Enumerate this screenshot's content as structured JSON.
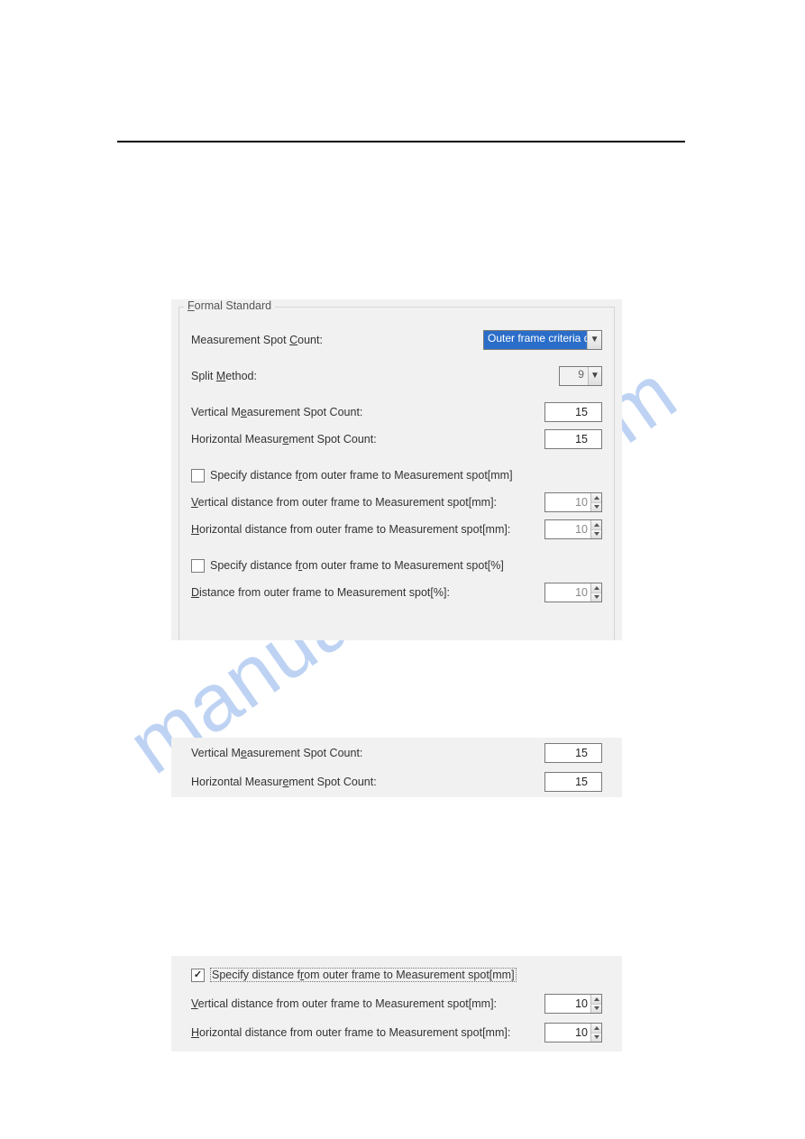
{
  "panel1": {
    "legend": "Formal Standard",
    "measurement_spot_count_label": "Measurement Spot Count:",
    "measurement_spot_count_value": "Outer frame criteria d",
    "split_method_label": "Split Method:",
    "split_method_value": "9",
    "vertical_count_label": "Vertical Measurement Spot Count:",
    "vertical_count_value": "15",
    "horizontal_count_label": "Horizontal Measurement Spot Count:",
    "horizontal_count_value": "15",
    "chk_mm_label": "Specify distance from outer frame to Measurement spot[mm]",
    "chk_mm_checked": false,
    "vdist_mm_label": "Vertical distance from outer frame to Measurement spot[mm]:",
    "vdist_mm_value": "10",
    "hdist_mm_label": "Horizontal distance from outer frame to Measurement spot[mm]:",
    "hdist_mm_value": "10",
    "chk_pct_label": "Specify distance from outer frame to Measurement spot[%]",
    "chk_pct_checked": false,
    "dist_pct_label": "Distance from outer frame to Measurement spot[%]:",
    "dist_pct_value": "10"
  },
  "panel2": {
    "vertical_count_label": "Vertical Measurement Spot Count:",
    "vertical_count_value": "15",
    "horizontal_count_label": "Horizontal Measurement Spot Count:",
    "horizontal_count_value": "15"
  },
  "panel3": {
    "chk_mm_label": "Specify distance from outer frame to Measurement spot[mm]",
    "chk_mm_checked": true,
    "vdist_mm_label": "Vertical distance from outer frame to Measurement spot[mm]:",
    "vdist_mm_value": "10",
    "hdist_mm_label": "Horizontal distance from outer frame to Measurement spot[mm]:",
    "hdist_mm_value": "10"
  },
  "watermark": "manualshive.com"
}
